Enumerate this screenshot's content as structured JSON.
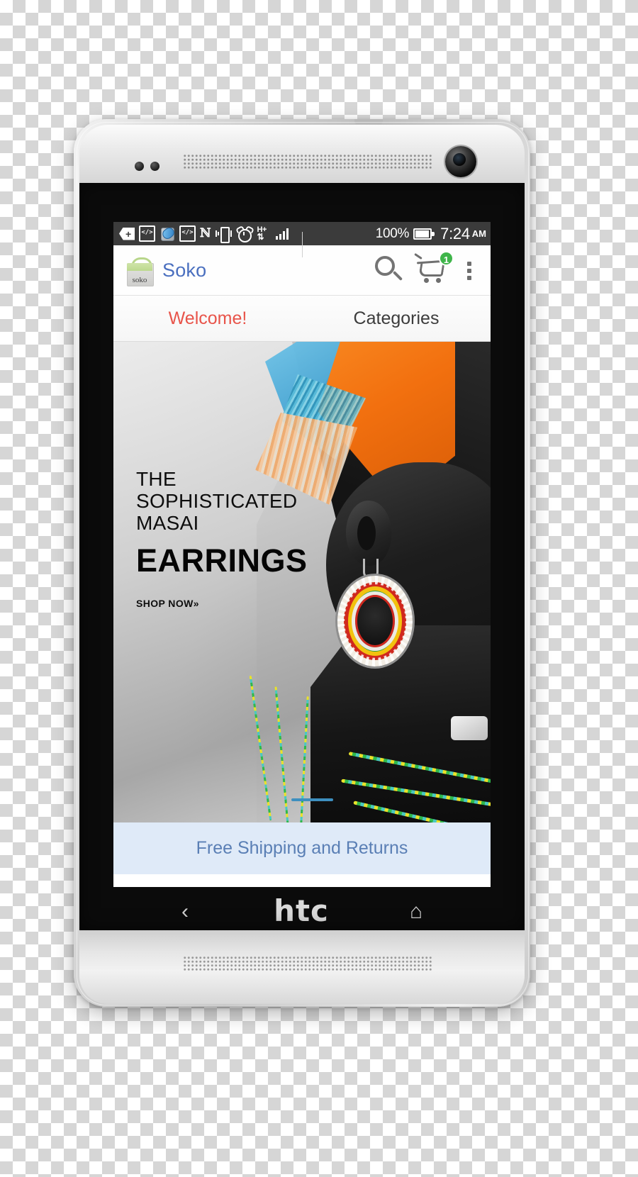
{
  "device": {
    "brand": "htc",
    "nav_back_icon": "back-chevron-icon",
    "nav_home_icon": "home-icon"
  },
  "statusbar": {
    "icons": [
      {
        "name": "download-tag-icon",
        "label": "+"
      },
      {
        "name": "code-brackets-icon",
        "label": "</>"
      },
      {
        "name": "battery-app-icon",
        "label": ""
      },
      {
        "name": "code-brackets-icon-2",
        "label": "</>"
      },
      {
        "name": "nfc-icon",
        "label": "N"
      },
      {
        "name": "vibrate-icon",
        "label": ""
      },
      {
        "name": "alarm-clock-icon",
        "label": ""
      },
      {
        "name": "hsplus-data-icon",
        "label": "H+"
      },
      {
        "name": "signal-bars-icon",
        "label": ""
      }
    ],
    "battery_percent": "100%",
    "time": "7:24",
    "am_pm": "AM",
    "background_color": "#3b3b3b"
  },
  "appbar": {
    "logo_word": "soko",
    "title": "Soko",
    "title_color": "#4a6fbf",
    "search_icon": "search-icon",
    "cart_icon": "shopping-cart-icon",
    "cart_badge_count": "1",
    "cart_badge_color": "#3fb54a",
    "overflow_icon": "overflow-menu-icon"
  },
  "tabs": [
    {
      "label": "Welcome!",
      "active": true,
      "color": "#e8544a"
    },
    {
      "label": "Categories",
      "active": false,
      "color": "#3c3c3c"
    }
  ],
  "hero": {
    "line1": "THE",
    "line2": "SOPHISTICATED",
    "line3": "MASAI",
    "headline": "EARRINGS",
    "cta": "SHOP NOW»",
    "carousel_indicator_color": "#3d8fbf"
  },
  "promo": {
    "text": "Free Shipping and Returns",
    "background_color": "#dfeaf8",
    "text_color": "#5a7fb5"
  }
}
